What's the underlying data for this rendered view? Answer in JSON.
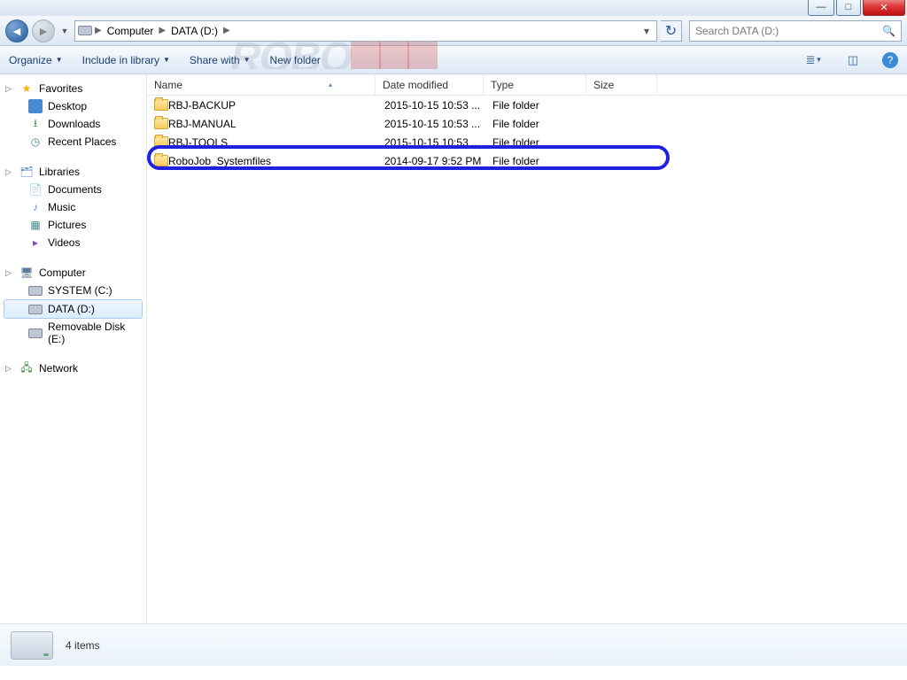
{
  "breadcrumb": {
    "root": "Computer",
    "drive": "DATA (D:)"
  },
  "search": {
    "placeholder": "Search DATA (D:)"
  },
  "toolbar": {
    "organize": "Organize",
    "include": "Include in library",
    "share": "Share with",
    "newfolder": "New folder"
  },
  "sidebar": {
    "favorites": {
      "label": "Favorites",
      "items": [
        "Desktop",
        "Downloads",
        "Recent Places"
      ]
    },
    "libraries": {
      "label": "Libraries",
      "items": [
        "Documents",
        "Music",
        "Pictures",
        "Videos"
      ]
    },
    "computer": {
      "label": "Computer",
      "items": [
        "SYSTEM (C:)",
        "DATA (D:)",
        "Removable Disk (E:)"
      ]
    },
    "network": {
      "label": "Network"
    }
  },
  "columns": {
    "name": "Name",
    "date": "Date modified",
    "type": "Type",
    "size": "Size"
  },
  "rows": [
    {
      "name": "RBJ-BACKUP",
      "date": "2015-10-15 10:53 ...",
      "type": "File folder"
    },
    {
      "name": "RBJ-MANUAL",
      "date": "2015-10-15 10:53 ...",
      "type": "File folder"
    },
    {
      "name": "RBJ-TOOLS",
      "date": "2015-10-15 10:53 ...",
      "type": "File folder"
    },
    {
      "name": "RoboJob_Systemfiles",
      "date": "2014-09-17 9:52 PM",
      "type": "File folder"
    }
  ],
  "status": {
    "count": "4 items"
  }
}
